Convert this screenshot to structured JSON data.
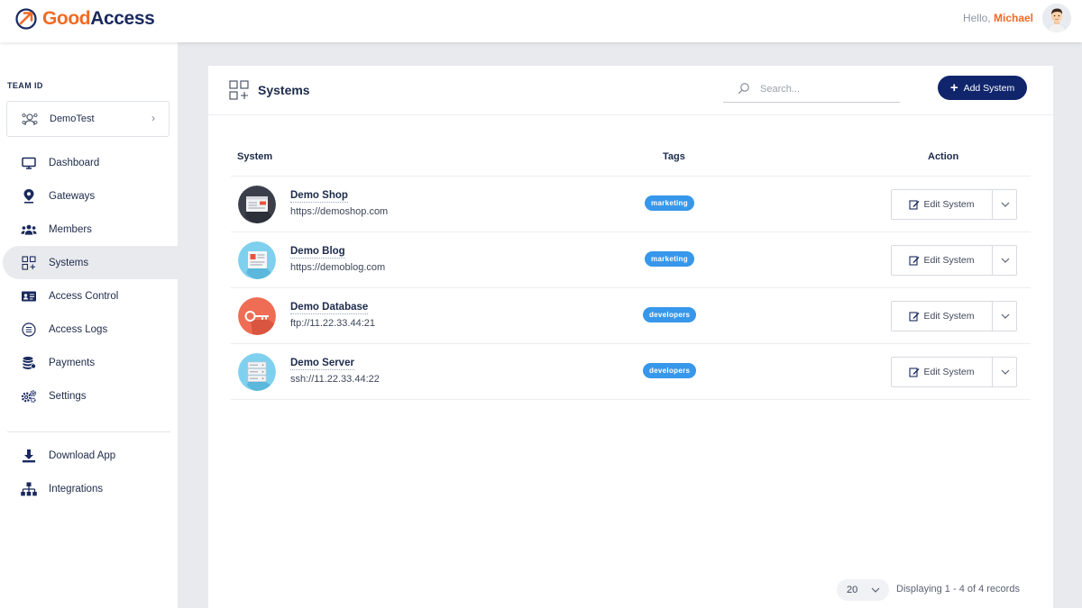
{
  "header": {
    "logo_part1": "Good",
    "logo_part2": "Access",
    "greeting": "Hello,",
    "user_name": "Michael"
  },
  "sidebar": {
    "team_label": "TEAM ID",
    "team_name": "DemoTest",
    "items": [
      {
        "label": "Dashboard",
        "icon": "monitor-icon"
      },
      {
        "label": "Gateways",
        "icon": "map-pin-icon"
      },
      {
        "label": "Members",
        "icon": "users-icon"
      },
      {
        "label": "Systems",
        "icon": "grid-plus-icon",
        "active": true
      },
      {
        "label": "Access Control",
        "icon": "id-card-icon"
      },
      {
        "label": "Access Logs",
        "icon": "list-circle-icon"
      },
      {
        "label": "Payments",
        "icon": "coins-icon"
      },
      {
        "label": "Settings",
        "icon": "gears-icon"
      }
    ],
    "bottom_items": [
      {
        "label": "Download App",
        "icon": "download-icon"
      },
      {
        "label": "Integrations",
        "icon": "sitemap-icon"
      }
    ]
  },
  "main": {
    "title": "Systems",
    "search_placeholder": "Search...",
    "add_button": "Add System",
    "columns": {
      "system": "System",
      "tags": "Tags",
      "action": "Action"
    },
    "rows": [
      {
        "name": "Demo Shop",
        "url": "https://demoshop.com",
        "tag": "marketing",
        "action": "Edit System",
        "icon": "shop-window-icon"
      },
      {
        "name": "Demo Blog",
        "url": "https://demoblog.com",
        "tag": "marketing",
        "action": "Edit System",
        "icon": "blog-page-icon"
      },
      {
        "name": "Demo Database",
        "url": "ftp://11.22.33.44:21",
        "tag": "developers",
        "action": "Edit System",
        "icon": "key-icon"
      },
      {
        "name": "Demo Server",
        "url": "ssh://11.22.33.44:22",
        "tag": "developers",
        "action": "Edit System",
        "icon": "server-rack-icon"
      }
    ],
    "page_size": "20",
    "records_text": "Displaying 1 - 4 of 4 records"
  },
  "colors": {
    "brand_orange": "#f26b23",
    "brand_navy": "#10256b",
    "tag_blue": "#3797ea",
    "background": "#e9eaee"
  }
}
